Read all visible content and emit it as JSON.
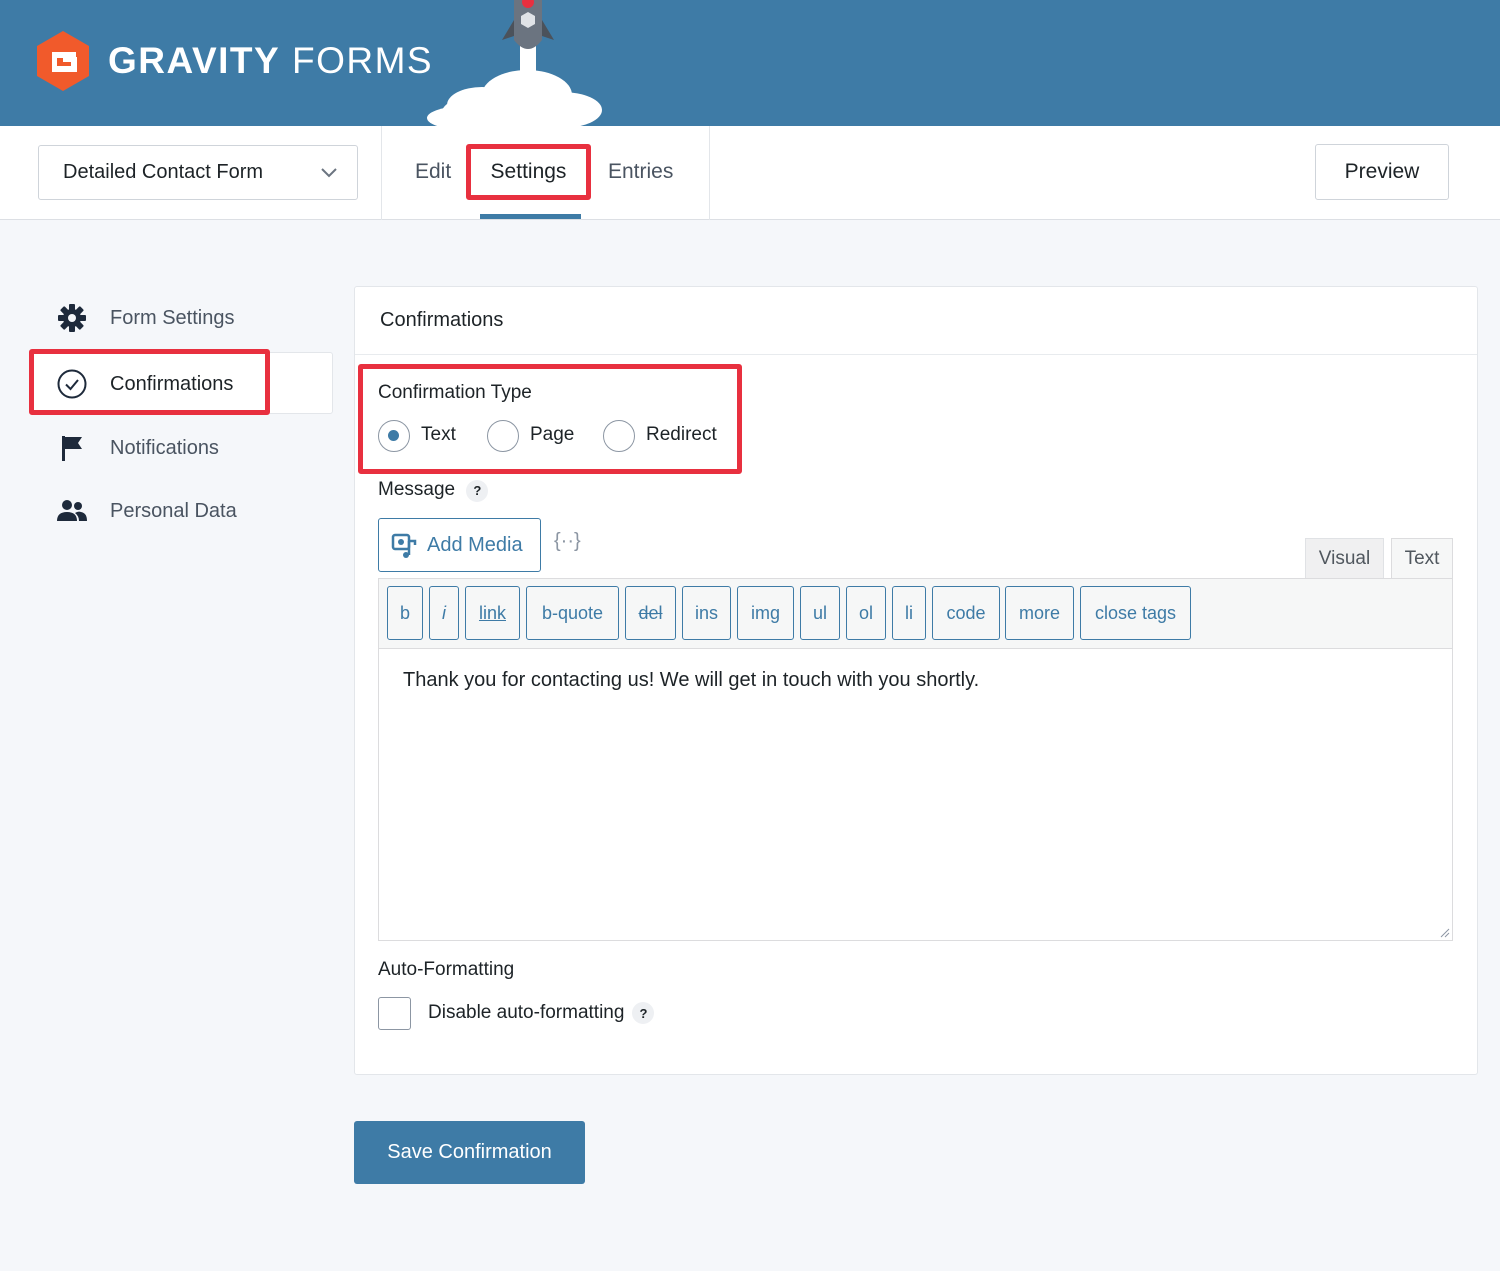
{
  "brand": {
    "name_bold": "GRAVITY",
    "name_light": "FORMS"
  },
  "toolbar": {
    "form_selector_value": "Detailed Contact Form",
    "tabs": [
      {
        "label": "Edit"
      },
      {
        "label": "Settings",
        "active": true
      },
      {
        "label": "Entries"
      }
    ],
    "preview_label": "Preview"
  },
  "sidebar": {
    "items": [
      {
        "label": "Form Settings",
        "icon": "gear-icon"
      },
      {
        "label": "Confirmations",
        "icon": "check-circle-icon",
        "active": true
      },
      {
        "label": "Notifications",
        "icon": "flag-icon"
      },
      {
        "label": "Personal Data",
        "icon": "people-icon"
      }
    ]
  },
  "panel": {
    "title": "Confirmations",
    "confirmation_type": {
      "label": "Confirmation Type",
      "options": [
        {
          "label": "Text",
          "selected": true
        },
        {
          "label": "Page",
          "selected": false
        },
        {
          "label": "Redirect",
          "selected": false
        }
      ]
    },
    "message": {
      "label": "Message",
      "help": "?",
      "add_media_label": "Add Media",
      "merge_tag_symbol": "{··}",
      "editor_tabs": [
        {
          "label": "Visual"
        },
        {
          "label": "Text",
          "active": true
        }
      ],
      "quicktags": [
        "b",
        "i",
        "link",
        "b-quote",
        "del",
        "ins",
        "img",
        "ul",
        "ol",
        "li",
        "code",
        "more",
        "close tags"
      ],
      "content": "Thank you for contacting us! We will get in touch with you shortly."
    },
    "auto_formatting": {
      "label": "Auto-Formatting",
      "checkbox_label": "Disable auto-formatting",
      "checked": false,
      "help": "?"
    }
  },
  "save_label": "Save Confirmation",
  "colors": {
    "brand_blue": "#3e7ba6",
    "highlight_red": "#e8303f",
    "logo_orange": "#f15a2b"
  }
}
